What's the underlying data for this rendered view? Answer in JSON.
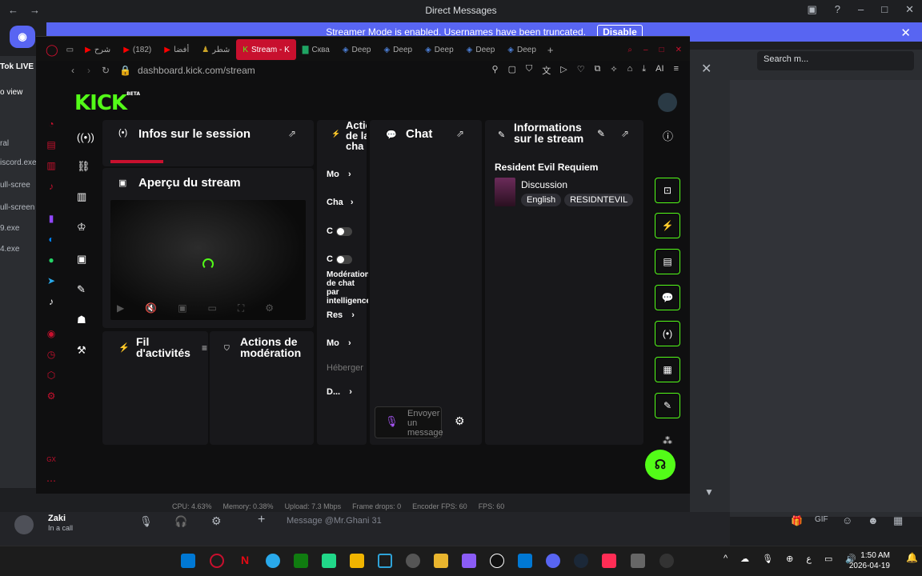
{
  "discord": {
    "title": "Direct Messages",
    "banner_text": "Streamer Mode is enabled. Usernames have been truncated.",
    "banner_button": "Disable",
    "search_placeholder": "Search m...",
    "channel_fragments": [
      "Tok LIVE",
      "o view",
      "ral",
      "iscord.exe",
      "ull-scree",
      "ull-screen",
      "9.exe",
      "4.exe"
    ],
    "user_name": "Zaki",
    "user_status": "In a call",
    "message_placeholder": "Message @Mr.Ghani 31"
  },
  "browser": {
    "url": "dashboard.kick.com/stream",
    "tabs": [
      {
        "label": "شرح",
        "icon": "youtube-icon"
      },
      {
        "label": "(182)",
        "icon": "youtube-icon"
      },
      {
        "label": "أفضا",
        "icon": "youtube-icon"
      },
      {
        "label": "شطر",
        "icon": "chess-icon"
      },
      {
        "label": "Stream - K",
        "icon": "kick-icon",
        "active": true
      },
      {
        "label": "Сква",
        "icon": "translate-icon"
      },
      {
        "label": "Deep",
        "icon": "deepl-icon"
      },
      {
        "label": "Deep",
        "icon": "deepl-icon"
      },
      {
        "label": "Deep",
        "icon": "deepl-icon"
      },
      {
        "label": "Deep",
        "icon": "deepl-icon"
      },
      {
        "label": "Deep",
        "icon": "deepl-icon"
      }
    ],
    "ai_label": "AI",
    "gx_label": "GX"
  },
  "kick": {
    "logo": "KICK",
    "logo_badge": "BETA",
    "session_title": "Infos sur le session",
    "preview_title": "Aperçu du stream",
    "activity_title": "Fil d'activités",
    "mod_actions_title": "Actions de modération",
    "mod_panel_title": "Actions de la cha",
    "mod_rows": [
      "Mo",
      "Cha",
      "C",
      "C",
      "Modération de chat par intelligence artificielle",
      "Res",
      "Mo",
      "Héberger",
      "D..."
    ],
    "chat_title": "Chat",
    "chat_input_placeholder": "Envoyer un message",
    "info_title": "Informations sur le stream",
    "game": "Resident Evil Requiem",
    "category": "Discussion",
    "tags": [
      "English",
      "RESIDNTEVIL"
    ]
  },
  "status_bar": {
    "cpu": "CPU: 4.63%",
    "memory": "Memory: 0.38%",
    "upload": "Upload: 7.3 Mbps",
    "frame_drops": "Frame drops: 0",
    "encoder_fps": "Encoder FPS: 60",
    "fps": "FPS: 60"
  },
  "taskbar": {
    "time": "1:50 AM",
    "date": "2026-04-19"
  },
  "colors": {
    "kick_green": "#53fc18",
    "discord_blurple": "#5865f2",
    "opera_red": "#c8102e"
  }
}
